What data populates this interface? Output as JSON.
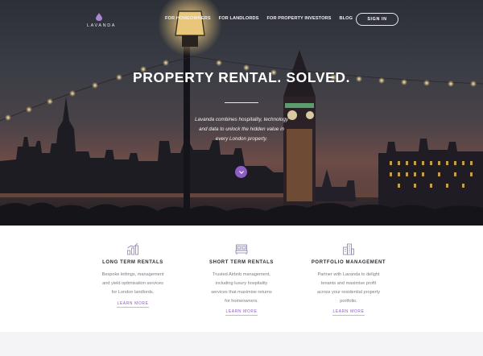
{
  "header": {
    "logo_text": "LAVANDA",
    "nav": [
      "FOR HOMEOWNERS",
      "FOR LANDLORDS",
      "FOR PROPERTY INVESTORS",
      "BLOG"
    ],
    "signin_label": "SIGN IN"
  },
  "hero": {
    "headline": "PROPERTY RENTAL. SOLVED.",
    "tagline_line1": "Lavanda combines hospitality, technology",
    "tagline_line2": "and data to unlock the hidden value in",
    "tagline_line3": "every London property.",
    "scroll_icon": "chevron-down-icon"
  },
  "features": [
    {
      "icon": "bar-chart-icon",
      "title": "LONG TERM RENTALS",
      "desc": [
        "Bespoke lettings, management",
        "and yield optimisation services",
        "for London landlords."
      ],
      "link": "LEARN MORE"
    },
    {
      "icon": "bed-icon",
      "title": "SHORT TERM RENTALS",
      "desc": [
        "Trusted Airbnb management,",
        "including luxury hospitality",
        "services that maximise returns",
        "for homeowners."
      ],
      "link": "LEARN MORE"
    },
    {
      "icon": "buildings-icon",
      "title": "PORTFOLIO MANAGEMENT",
      "desc": [
        "Partner with Lavanda to delight",
        "tenants and maximise profit",
        "across your residential property",
        "portfolio."
      ],
      "link": "LEARN MORE"
    }
  ],
  "colors": {
    "accent": "#8d5ec6",
    "hero_text": "#ffffff",
    "feature_title": "#2b2b33",
    "feature_text": "#7b7b86"
  }
}
